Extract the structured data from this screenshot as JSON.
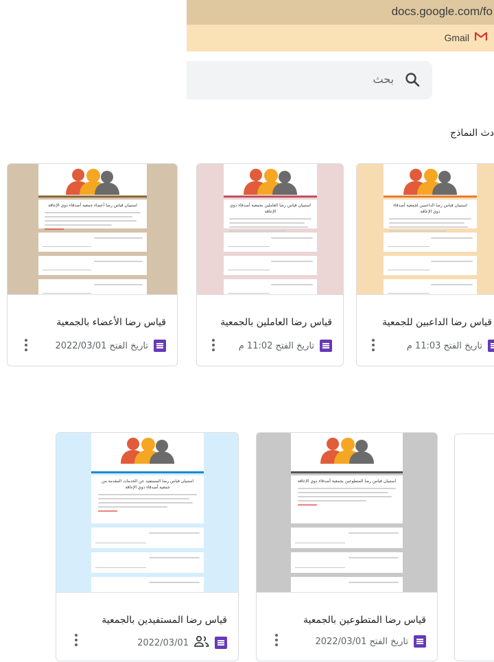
{
  "browser": {
    "url": "docs.google.com/fo",
    "bookmark_gmail": "Gmail",
    "colors": {
      "url_bar": "#dfc8a0",
      "bookmark_bar": "#fbe1b6"
    }
  },
  "search": {
    "placeholder": "بحث",
    "icon": "search-icon"
  },
  "section": {
    "title": "دث النماذج"
  },
  "cards": [
    {
      "title": "قياس رضا الداعبين للجمعية",
      "meta": "تاريخ الفتح 11:03 م",
      "thumb_bg": "#f8dcb1",
      "thumb_title": "استبيان قياس رضا الداعمين لجمعية أصدقاء ذوي الإعاقة",
      "accent": "#e67c30"
    },
    {
      "title": "قياس رضا العاملين بالجمعية",
      "meta": "تاريخ الفتح 11:02 م",
      "thumb_bg": "#ebd5d5",
      "thumb_title": "استبيان قياس رضا العاملين بجمعية أصدقاء ذوي الإعاقة",
      "accent": "#c05060"
    },
    {
      "title": "قياس رضا الأعضاء بالجمعية",
      "meta": "تاريخ الفتح 2022/03/01",
      "thumb_bg": "#d5c2aa",
      "thumb_title": "استبيان قياس رضا أعضاء جمعية أصدقاء ذوي الإعاقة",
      "accent": "#8a6a3a"
    },
    {
      "title": "قياس رضا المتطوعين بالجمعية",
      "meta": "تاريخ الفتح 2022/03/01",
      "thumb_bg": "#c8c8c8",
      "thumb_title": "استبيان قياس رضا المتطوعين بجمعية أصدقاء ذوي الإعاقة",
      "accent": "#555555"
    },
    {
      "title": "قياس رضا المستفيدين بالجمعية",
      "meta": "2022/03/01",
      "thumb_bg": "#d6eefc",
      "thumb_title": "استبيان قياس رضا المستفيد عن الخدمات المقدمة من جمعية أصدقاء ذوي الإعاقة",
      "accent": "#1a88d6",
      "shared": true
    }
  ],
  "icons": {
    "forms": "forms-icon",
    "shared": "people-icon",
    "more": "more-vert-icon",
    "gmail": "gmail-icon"
  }
}
